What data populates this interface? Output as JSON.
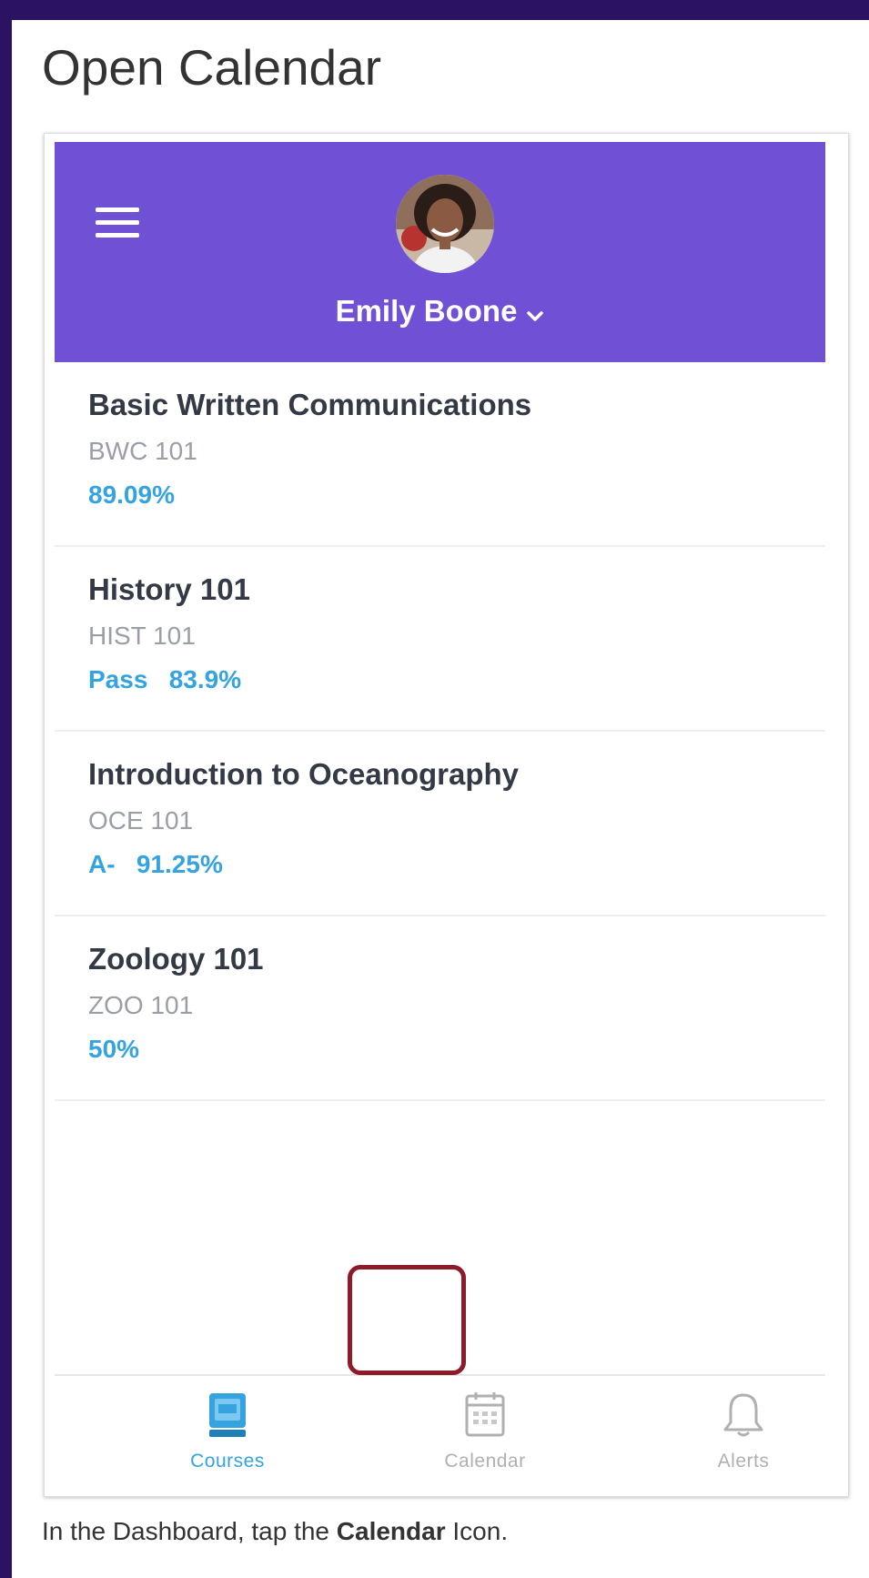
{
  "page": {
    "title": "Open Calendar",
    "instruction": {
      "prefix": "In the Dashboard, tap the ",
      "bold": "Calendar",
      "suffix": " Icon."
    }
  },
  "header": {
    "menu_icon": "hamburger-icon",
    "user_name": "Emily Boone",
    "chevron_icon": "chevron-down-icon",
    "background_color": "#7050d4"
  },
  "courses": [
    {
      "name": "Basic Written Communications",
      "code": "BWC 101",
      "grade": "89.09%"
    },
    {
      "name": "History 101",
      "code": "HIST 101",
      "grade": "Pass   83.9%"
    },
    {
      "name": "Introduction to Oceanography",
      "code": "OCE 101",
      "grade": "A-   91.25%"
    },
    {
      "name": "Zoology 101",
      "code": "ZOO 101",
      "grade": "50%"
    }
  ],
  "tabs": [
    {
      "label": "Courses",
      "icon": "courses-book-icon",
      "active": true
    },
    {
      "label": "Calendar",
      "icon": "calendar-icon",
      "active": false,
      "highlighted": true
    },
    {
      "label": "Alerts",
      "icon": "bell-icon",
      "active": false
    }
  ],
  "colors": {
    "accent": "#34a3e0",
    "highlight": "#8e1b2a",
    "frame": "#2c1262"
  }
}
